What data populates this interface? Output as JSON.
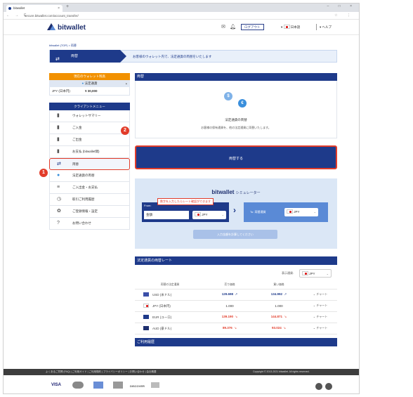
{
  "browser": {
    "tab_title": "bitwallet",
    "new_tab": "+",
    "window_controls": "–  □  ×",
    "nav_controls": "← → C",
    "url": "secure.bitwallet.com/account_transfer/"
  },
  "header": {
    "logo": "bitwallet",
    "logout": "ログアウト",
    "language": "日本語",
    "help": "ヘルプ"
  },
  "breadcrumb": "bitwallet (TOP)  >  両替",
  "page_bar": {
    "label": "両替",
    "message": "お客様のウォレット内で、法定通貨の両替をいたします"
  },
  "sidebar": {
    "balance_title": "現在のウォレット残高",
    "balance_sub": "法定通貨",
    "balance_currency": "JPY (日本円)",
    "balance_value": "¥ 30,000",
    "client_menu": "クライアントメニュー",
    "items": [
      {
        "label": "ウォレットサマリー",
        "icon": "wallet-icon"
      },
      {
        "label": "ご入金",
        "icon": "deposit-icon"
      },
      {
        "label": "ご出金",
        "icon": "withdraw-icon"
      },
      {
        "label": "お支払 (bitwallet間)",
        "icon": "payment-icon"
      },
      {
        "label": "両替",
        "icon": "exchange-icon"
      },
      {
        "label": "法定通貨の両替",
        "icon": "coin-icon"
      },
      {
        "label": "ご入出金・お支払",
        "icon": "list-icon"
      },
      {
        "label": "取引ご利用履歴",
        "icon": "history-icon"
      },
      {
        "label": "ご登録情報・設定",
        "icon": "gear-icon"
      },
      {
        "label": "お問い合わせ",
        "icon": "help-icon"
      }
    ]
  },
  "annotations": {
    "badge1": "1",
    "badge2": "2"
  },
  "exchange": {
    "section_title": "両替",
    "coin_a": "$",
    "coin_b": "€",
    "title": "法定通貨の両替",
    "description": "お客様の保有通貨を、他の法定通貨に両替いたします。",
    "button": "両替する"
  },
  "simulator": {
    "title": "bitwallet",
    "title_suffix": "シミュレーター",
    "from_label": "From:",
    "tooltip": "数字を入力したらレート確認ができます",
    "amount": "金額",
    "from_currency": "JPY",
    "to_label": "To: 両替通貨",
    "to_currency": "JPY",
    "calc_button": "入力金額を計算してください"
  },
  "rates": {
    "section_title": "法定通貨の両替レート",
    "display_label": "表示通貨:",
    "display_currency": "JPY",
    "columns": [
      "両替の法定通貨",
      "売り価格",
      "買い価格",
      ""
    ],
    "rows": [
      {
        "currency": "USD (米ドル)",
        "sell": "129.698",
        "sell_trend": "↗",
        "buy": "134.992",
        "buy_trend": "↗",
        "chart": "チャート",
        "flag": "#3b4fa8"
      },
      {
        "currency": "JPY (日本円)",
        "sell": "1.000",
        "sell_trend": "",
        "buy": "1.000",
        "buy_trend": "",
        "chart": "チャート",
        "flag": "#ffffff"
      },
      {
        "currency": "EUR (ユーロ)",
        "sell": "139.190",
        "sell_trend": "↘",
        "buy": "144.871",
        "buy_trend": "↘",
        "chart": "チャート",
        "flag": "#1e3a8a"
      },
      {
        "currency": "AUD (豪ドル)",
        "sell": "89.376",
        "sell_trend": "↘",
        "buy": "93.024",
        "buy_trend": "↘",
        "chart": "チャート",
        "flag": "#1e2f6e"
      }
    ],
    "history_title": "ご利用履歴"
  },
  "footer": {
    "links": "よくあるご質問 (FAQ)  |  ご利用ガイド  |  ご利用規約  |  プライバシーポリシー  |  お問い合わせ  |  会社概要",
    "copyright": "Copyright © 2013-2021 bitwallet. All rights reserved.",
    "payments": [
      "VISA",
      "DISCOVER"
    ]
  },
  "colors": {
    "brand": "#1e3a8a",
    "accent": "#f29100",
    "highlight": "#e23c2a"
  }
}
